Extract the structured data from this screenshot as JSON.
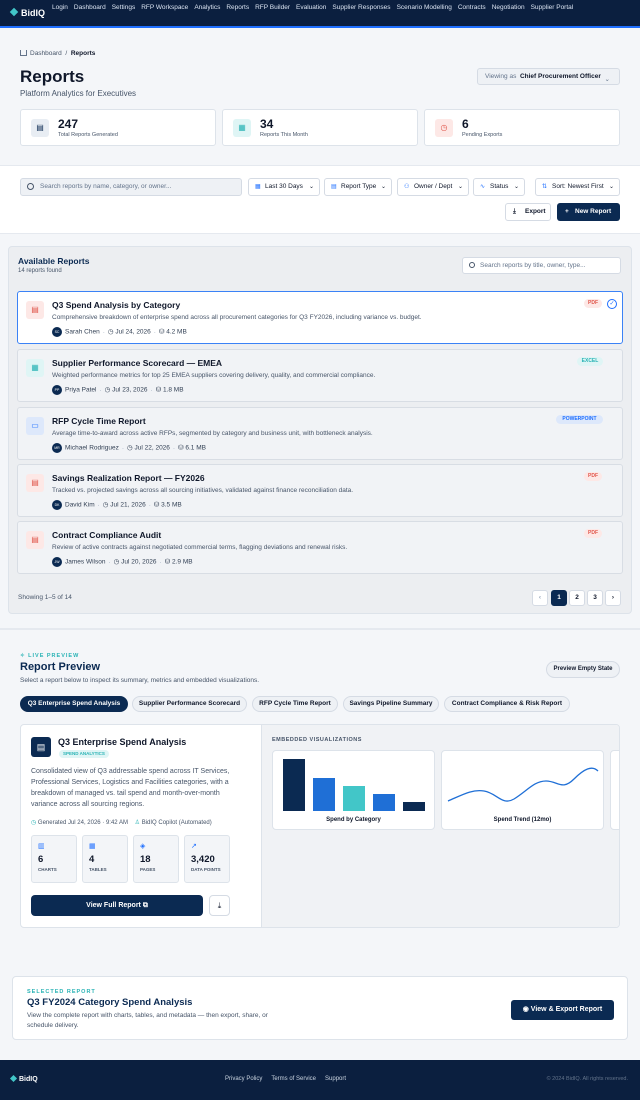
{
  "brand": "BidIQ",
  "nav": [
    "Login",
    "Dashboard",
    "Settings",
    "RFP Workspace",
    "Analytics",
    "Reports",
    "RFP Builder",
    "Evaluation",
    "Supplier Responses",
    "Scenario Modelling",
    "Contracts",
    "Negotiation",
    "Supplier Portal"
  ],
  "breadcrumb": {
    "home": "Dashboard",
    "current": "Reports"
  },
  "page": {
    "title": "Reports",
    "subtitle": "Platform Analytics for Executives",
    "viewing_label": "Viewing as",
    "viewing_value": "Chief Procurement Officer"
  },
  "stats": [
    {
      "value": "247",
      "label": "Total Reports Generated",
      "bg": "#e8edf3",
      "fg": "#0b2a52",
      "glyph": "▤"
    },
    {
      "value": "34",
      "label": "Reports This Month",
      "bg": "#dff5f5",
      "fg": "#29b3b5",
      "glyph": "▦"
    },
    {
      "value": "6",
      "label": "Pending Exports",
      "bg": "#fde8e6",
      "fg": "#e0564b",
      "glyph": "◷"
    }
  ],
  "toolbar": {
    "search_placeholder": "Search reports by name, category, or owner...",
    "date": "Last 30 Days",
    "type": "Report Type",
    "owner": "Owner / Dept",
    "status": "Status",
    "sort": "Sort: Newest First",
    "export": "Export",
    "new_report": "New Report"
  },
  "available": {
    "title": "Available Reports",
    "count": "14 reports found",
    "search_placeholder": "Search reports by title, owner, type...",
    "showing": "Showing 1–5 of 14",
    "pages": [
      "1",
      "2",
      "3"
    ]
  },
  "reports": [
    {
      "title": "Q3 Spend Analysis by Category",
      "desc": "Comprehensive breakdown of enterprise spend across all procurement categories for Q3 FY2026, including variance vs. budget.",
      "initials": "SC",
      "owner": "Sarah Chen",
      "date": "Jul 24, 2026",
      "size": "4.2 MB",
      "badge": "PDF"
    },
    {
      "title": "Supplier Performance Scorecard — EMEA",
      "desc": "Weighted performance metrics for top 25 EMEA suppliers covering delivery, quality, and commercial compliance.",
      "initials": "PP",
      "owner": "Priya Patel",
      "date": "Jul 23, 2026",
      "size": "1.8 MB",
      "badge": "EXCEL"
    },
    {
      "title": "RFP Cycle Time Report",
      "desc": "Average time-to-award across active RFPs, segmented by category and business unit, with bottleneck analysis.",
      "initials": "MR",
      "owner": "Michael Rodriguez",
      "date": "Jul 22, 2026",
      "size": "6.1 MB",
      "badge": "POWERPOINT"
    },
    {
      "title": "Savings Realization Report — FY2026",
      "desc": "Tracked vs. projected savings across all sourcing initiatives, validated against finance reconciliation data.",
      "initials": "DK",
      "owner": "David Kim",
      "date": "Jul 21, 2026",
      "size": "3.5 MB",
      "badge": "PDF"
    },
    {
      "title": "Contract Compliance Audit",
      "desc": "Review of active contracts against negotiated commercial terms, flagging deviations and renewal risks.",
      "initials": "JW",
      "owner": "James Wilson",
      "date": "Jul 20, 2026",
      "size": "2.9 MB",
      "badge": "PDF"
    }
  ],
  "preview": {
    "live": "LIVE PREVIEW",
    "title": "Report Preview",
    "subtitle": "Select a report below to inspect its summary, metrics and embedded visualizations.",
    "empty_btn": "Preview Empty State",
    "tabs": [
      "Q3 Enterprise Spend Analysis",
      "Supplier Performance Scorecard",
      "RFP Cycle Time Report",
      "Savings Pipeline Summary",
      "Contract Compliance & Risk Report"
    ],
    "report_title": "Q3 Enterprise Spend Analysis",
    "badge": "SPEND ANALYTICS",
    "desc": "Consolidated view of Q3 addressable spend across IT Services, Professional Services, Logistics and Facilities categories, with a breakdown of managed vs. tail spend and month-over-month variance across all sourcing regions.",
    "generated": "Generated Jul 24, 2026 · 9:42 AM",
    "author": "BidIQ Copilot (Automated)",
    "metrics": [
      {
        "value": "6",
        "label": "CHARTS"
      },
      {
        "value": "4",
        "label": "TABLES"
      },
      {
        "value": "18",
        "label": "PAGES"
      },
      {
        "value": "3,420",
        "label": "DATA POINTS"
      }
    ],
    "view_full": "View Full Report",
    "embedded": "EMBEDDED VISUALIZATIONS",
    "viz1": "Spend by Category",
    "viz2": "Spend Trend (12mo)"
  },
  "selected": {
    "label": "SELECTED REPORT",
    "title": "Q3 FY2024 Category Spend Analysis",
    "desc": "View the complete report with charts, tables, and metadata — then export, share, or schedule delivery.",
    "button": "View & Export Report"
  },
  "footer": {
    "brand": "BidIQ",
    "links": [
      "Privacy Policy",
      "Terms of Service",
      "Support"
    ],
    "copyright": "© 2024 BidIQ. All rights reserved."
  },
  "colors": {
    "navy": "#0b2a52",
    "teal": "#42c6c8",
    "blue": "#1f6fff"
  }
}
